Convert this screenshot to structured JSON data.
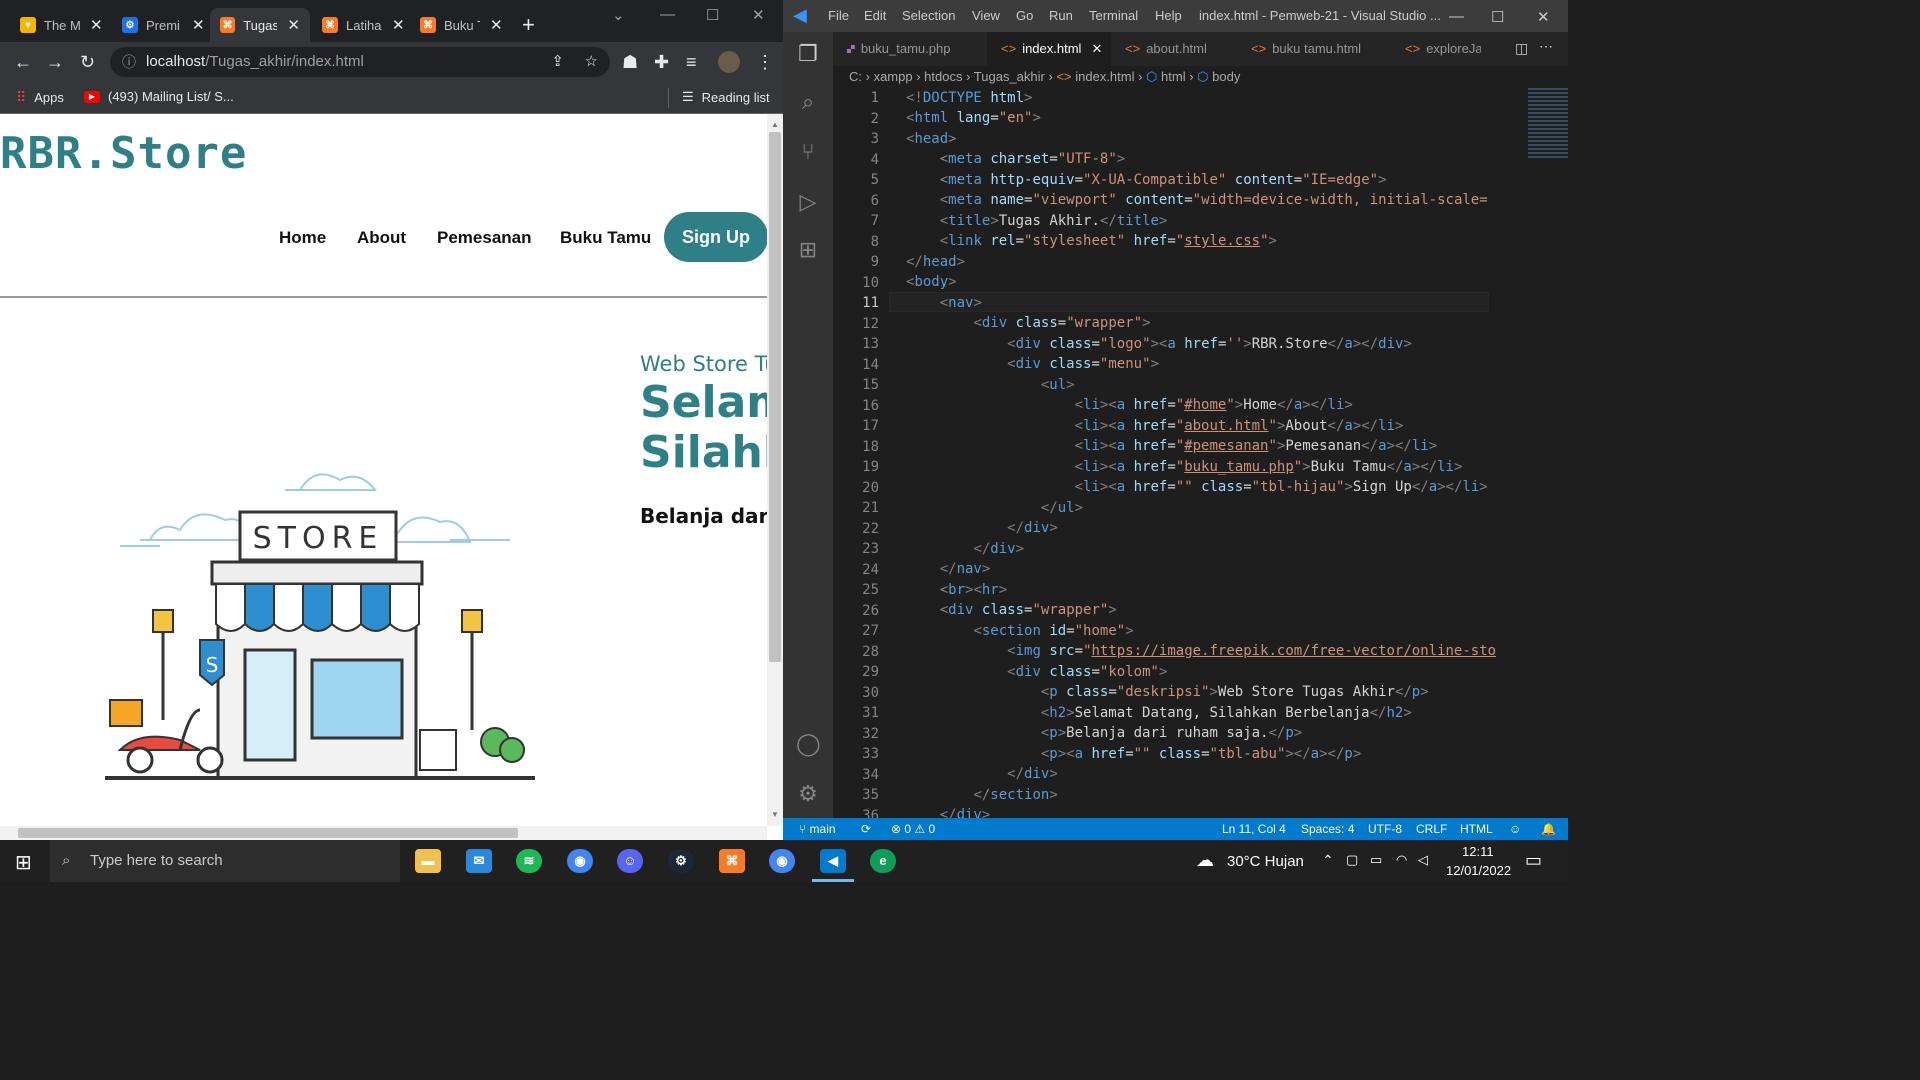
{
  "browser": {
    "tabs": [
      {
        "title": "The M",
        "favicon_color": "#f4b400"
      },
      {
        "title": "Premi",
        "favicon_color": "#1a73e8"
      },
      {
        "title": "Tugas",
        "favicon_color": "#fb7a24"
      },
      {
        "title": "Latiha",
        "favicon_color": "#fb7a24"
      },
      {
        "title": "Buku T",
        "favicon_color": "#fb7a24"
      }
    ],
    "new_tab": "+",
    "address_host": "localhost",
    "address_path": "/Tugas_akhir/index.html",
    "bookmarks": [
      {
        "label": "Apps"
      },
      {
        "label": "(493) Mailing List/ S..."
      }
    ],
    "reading_list": "Reading list"
  },
  "site": {
    "logo": "RBR.Store",
    "nav": [
      "Home",
      "About",
      "Pemesanan",
      "Buku Tamu"
    ],
    "signup": "Sign Up",
    "description": "Web Store Tugas Akhir",
    "heading": "Selamat Datang, Silahkan Berbelanja",
    "paragraph": "Belanja dari ruham saja.",
    "illustration_sign": "STORE",
    "badge": "S",
    "accent": "#2e7f86"
  },
  "vscode": {
    "menu": [
      "File",
      "Edit",
      "Selection",
      "View",
      "Go",
      "Run",
      "Terminal",
      "Help"
    ],
    "window_title": "index.html - Pemweb-21 - Visual Studio ...",
    "tabs": [
      {
        "label": "buku_tamu.php",
        "active": false
      },
      {
        "label": "index.html",
        "active": true
      },
      {
        "label": "about.html",
        "active": false
      },
      {
        "label": "buku tamu.html",
        "active": false
      },
      {
        "label": "exploreJa",
        "active": false
      }
    ],
    "breadcrumb": [
      "C:",
      "xampp",
      "htdocs",
      "Tugas_akhir",
      "index.html",
      "html",
      "body"
    ],
    "line_numbers": [
      "1",
      "2",
      "3",
      "4",
      "5",
      "6",
      "7",
      "8",
      "9",
      "10",
      "11",
      "12",
      "13",
      "14",
      "15",
      "16",
      "17",
      "18",
      "19",
      "20",
      "21",
      "22",
      "23",
      "24",
      "25",
      "26",
      "27",
      "28",
      "29",
      "30",
      "31",
      "32",
      "33",
      "34",
      "35",
      "36"
    ],
    "status": {
      "branch": "main",
      "errors": "0",
      "warnings": "0",
      "position": "Ln 11, Col 4",
      "spaces": "Spaces: 4",
      "encoding": "UTF-8",
      "eol": "CRLF",
      "language": "HTML"
    }
  },
  "taskbar": {
    "search_placeholder": "Type here to search",
    "weather": "30°C  Hujan",
    "time": "12:11",
    "date": "12/01/2022"
  }
}
